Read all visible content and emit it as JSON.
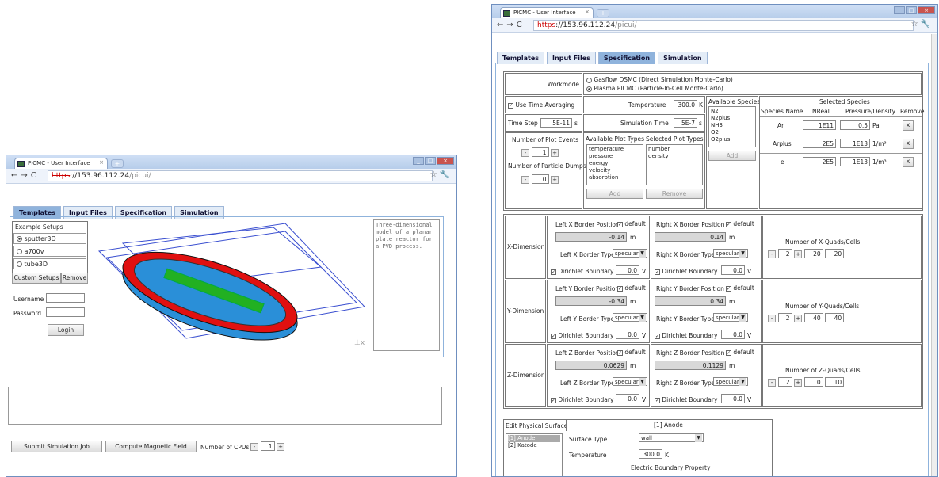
{
  "left": {
    "tab_title": "PICMC - User Interface",
    "url": {
      "scheme": "https",
      "host": "://153.96.112.24",
      "path": "/picui/"
    },
    "tabs": [
      "Templates",
      "Input Files",
      "Specification",
      "Simulation"
    ],
    "example_setups_label": "Example Setups",
    "setups": [
      "sputter3D",
      "a700v",
      "tube3D"
    ],
    "custom_setups": "Custom Setups",
    "remove": "Remove",
    "username_label": "Username",
    "password_label": "Password",
    "login": "Login",
    "description": "Three-dimensional model of a planar plate reactor for a PVD process.",
    "submit": "Submit Simulation Job",
    "compute": "Compute Magnetic Field",
    "cpus_label": "Number of CPUs",
    "cpus": "1"
  },
  "right": {
    "tab_title": "PICMC - User Interface",
    "url": {
      "scheme": "https",
      "host": "://153.96.112.24",
      "path": "/picui/"
    },
    "tabs": [
      "Templates",
      "Input Files",
      "Specification",
      "Simulation"
    ],
    "workmode_label": "Workmode",
    "workmodes": [
      "Gasflow DSMC (Direct Simulation Monte-Carlo)",
      "Plasma PICMC (Particle-In-Cell Monte-Carlo)"
    ],
    "use_time_averaging": "Use Time Averaging",
    "temperature_label": "Temperature",
    "temperature": "300.0",
    "temp_unit": "K",
    "time_step_label": "Time Step",
    "time_step": "5E-11",
    "s": "s",
    "sim_time_label": "Simulation Time",
    "sim_time": "5E-7",
    "plot_events_label": "Number of Plot Events",
    "plot_events": "1",
    "particle_dumps_label": "Number of Particle Dumps",
    "particle_dumps": "0",
    "avail_plot_label": "Available Plot Types",
    "sel_plot_label": "Selected Plot Types",
    "avail_plot": [
      "temperature",
      "pressure",
      "energy",
      "velocity",
      "absorption"
    ],
    "sel_plot": [
      "number",
      "density"
    ],
    "add": "Add",
    "remove": "Remove",
    "avail_species_label": "Available Species",
    "avail_species": [
      "N2",
      "N2plus",
      "NH3",
      "O2",
      "O2plus"
    ],
    "selected_species_label": "Selected Species",
    "species_headers": [
      "Species Name",
      "NReal",
      "Pressure/Density",
      "Remove"
    ],
    "species": [
      {
        "name": "Ar",
        "nreal": "1E11",
        "pd": "0.5",
        "unit": "Pa"
      },
      {
        "name": "Arplus",
        "nreal": "2E5",
        "pd": "1E13",
        "unit": "1/m³"
      },
      {
        "name": "e",
        "nreal": "2E5",
        "pd": "1E13",
        "unit": "1/m³"
      }
    ],
    "x_btn": "x",
    "default": "default",
    "m": "m",
    "v": "V",
    "specular": "specular",
    "dims": [
      {
        "name": "X-Dimension",
        "axis": "X",
        "left": "-0.14",
        "right": "0.14",
        "quads": "2",
        "c1": "20",
        "c2": "20",
        "lb": "0.0",
        "rb": "0.0"
      },
      {
        "name": "Y-Dimension",
        "axis": "Y",
        "left": "-0.34",
        "right": "0.34",
        "quads": "2",
        "c1": "40",
        "c2": "40",
        "lb": "0.0",
        "rb": "0.0"
      },
      {
        "name": "Z-Dimension",
        "axis": "Z",
        "left": "0.0629",
        "right": "0.1129",
        "quads": "2",
        "c1": "10",
        "c2": "10",
        "lb": "0.0",
        "rb": "0.0"
      }
    ],
    "edit_surface_label": "Edit Physical Surface",
    "surfaces": [
      "[1] Anode",
      "[2] Katode"
    ],
    "surface_title": "[1] Anode",
    "surface_type_label": "Surface Type",
    "surface_type": "wall",
    "surface_temp_label": "Temperature",
    "surface_temp": "300.0",
    "ebp_label": "Electric Boundary Property"
  }
}
